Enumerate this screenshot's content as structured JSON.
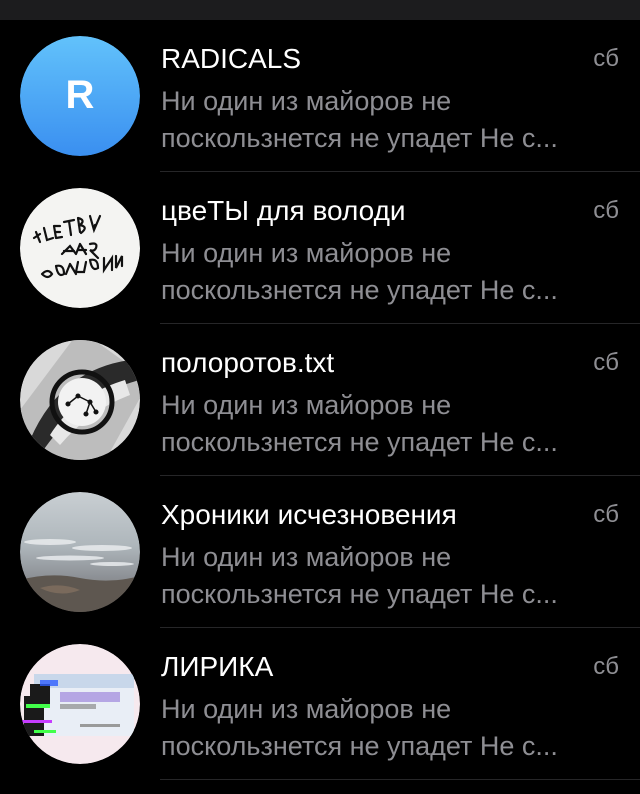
{
  "chats": [
    {
      "title": "RADICALS",
      "date": "сб",
      "preview_line1": "Ни один из майоров не",
      "preview_line2": "поскользнется не упадет Не с...",
      "avatar": {
        "type": "letter",
        "letter": "R",
        "color_top": "#62c2fb",
        "color_bottom": "#3a8ff0"
      }
    },
    {
      "title": "цвеТЫ для володи",
      "date": "сб",
      "preview_line1": "Ни один из майоров не",
      "preview_line2": "поскользнется не упадет Не с...",
      "avatar": {
        "type": "image",
        "icon": "handwritten-sticker-icon",
        "logo_text": "ЦВЕТЫ ДЛЯ ВОЛОДИ"
      }
    },
    {
      "title": "полоротов.txt",
      "date": "сб",
      "preview_line1": "Ни один из майоров не",
      "preview_line2": "поскользнется не упадет Не с...",
      "avatar": {
        "type": "image",
        "icon": "constellation-drawing-icon"
      }
    },
    {
      "title": "Хроники исчезновения",
      "date": "сб",
      "preview_line1": "Ни один из майоров не",
      "preview_line2": "поскользнется не упадет Не с...",
      "avatar": {
        "type": "image",
        "icon": "sea-photo-icon"
      }
    },
    {
      "title": "ЛИРИКА",
      "date": "сб",
      "preview_line1": "Ни один из майоров не",
      "preview_line2": "поскользнется не упадет Не с...",
      "avatar": {
        "type": "image",
        "icon": "medicine-box-icon",
        "logo_text": "ЛИРИКА 300 мг"
      }
    }
  ]
}
